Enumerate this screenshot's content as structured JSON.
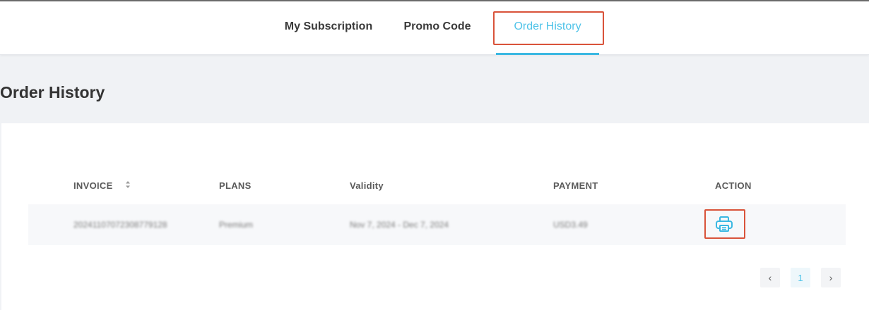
{
  "tabs": [
    {
      "label": "My Subscription"
    },
    {
      "label": "Promo Code"
    },
    {
      "label": "Order History",
      "active": true
    }
  ],
  "page_title": "Order History",
  "table": {
    "columns": [
      "INVOICE",
      "PLANS",
      "Validity",
      "PAYMENT",
      "ACTION"
    ],
    "rows": [
      {
        "invoice": "20241107072308779128",
        "plan": "Premium",
        "validity": "Nov 7, 2024 - Dec 7, 2024",
        "payment": "USD3.49"
      }
    ]
  },
  "pagination": {
    "prev": "‹",
    "current": "1",
    "next": "›"
  },
  "icons": {
    "sort": "sort-icon",
    "print": "printer-icon"
  },
  "colors": {
    "accent": "#3ab8e2",
    "highlight": "#d9533a"
  }
}
